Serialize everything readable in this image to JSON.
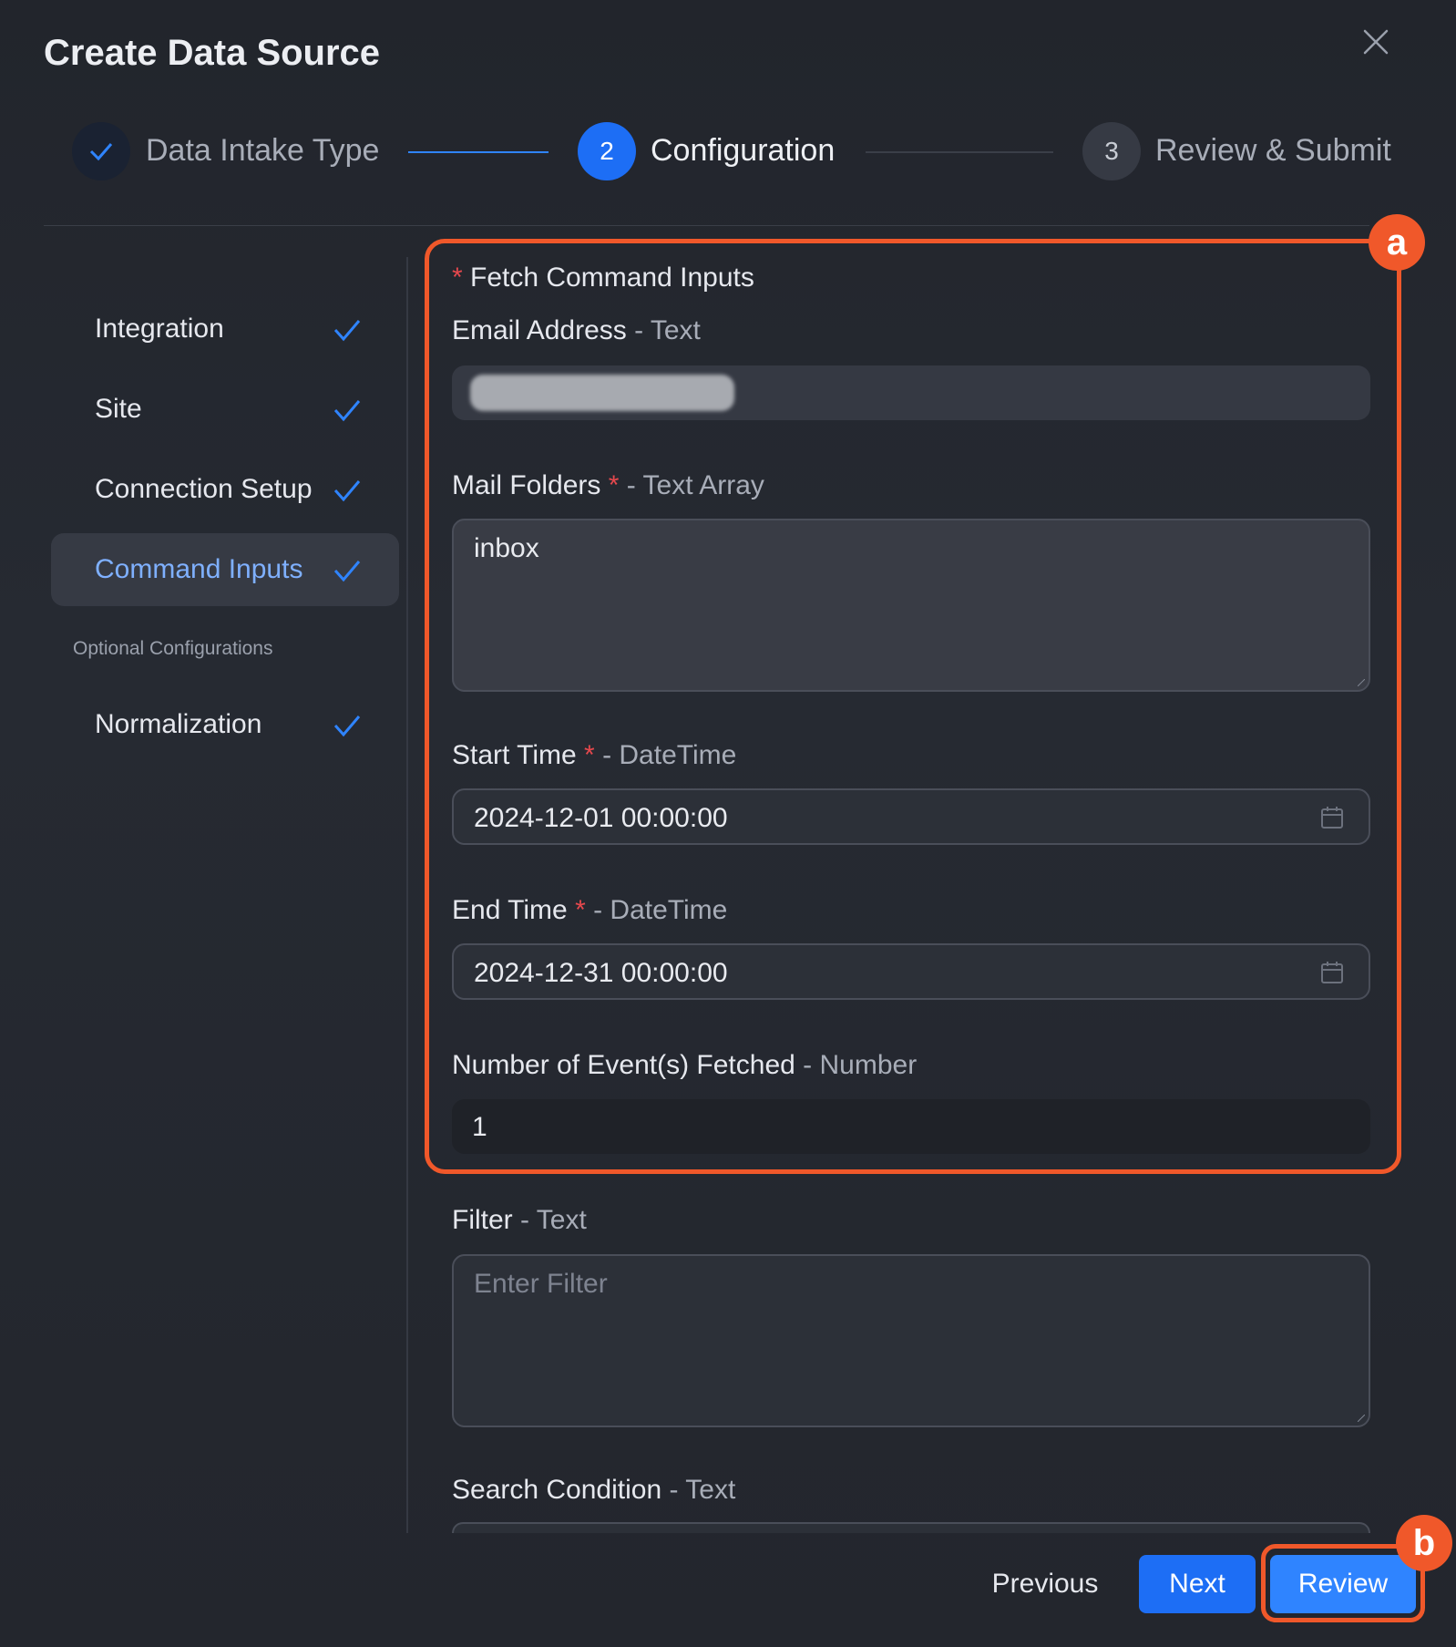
{
  "dialog": {
    "title": "Create Data Source"
  },
  "stepper": {
    "steps": [
      {
        "label": "Data Intake Type",
        "status": "done"
      },
      {
        "number": "2",
        "label": "Configuration",
        "status": "active"
      },
      {
        "number": "3",
        "label": "Review & Submit",
        "status": "pending"
      }
    ]
  },
  "sidebar": {
    "items": [
      {
        "label": "Integration"
      },
      {
        "label": "Site"
      },
      {
        "label": "Connection Setup"
      },
      {
        "label": "Command Inputs"
      }
    ],
    "optional_heading": "Optional Configurations",
    "optional_items": [
      {
        "label": "Normalization"
      }
    ]
  },
  "form": {
    "section_title": "Fetch Command Inputs",
    "section_required_mark": "*",
    "email": {
      "label": "Email Address",
      "type": " - Text"
    },
    "mail_folders": {
      "label": "Mail Folders",
      "req": "*",
      "type": " - Text Array",
      "value": "inbox"
    },
    "start_time": {
      "label": "Start Time",
      "req": "*",
      "type": " - DateTime",
      "value": "2024-12-01 00:00:00"
    },
    "end_time": {
      "label": "End Time",
      "req": "*",
      "type": " - DateTime",
      "value": "2024-12-31 00:00:00"
    },
    "num_events": {
      "label": "Number of Event(s) Fetched",
      "type": " - Number",
      "value": "1"
    },
    "filter": {
      "label": "Filter",
      "type": " - Text",
      "placeholder": "Enter Filter"
    },
    "search_condition": {
      "label": "Search Condition",
      "type": " - Text"
    }
  },
  "annotations": {
    "a": "a",
    "b": "b"
  },
  "footer": {
    "previous": "Previous",
    "next": "Next",
    "review": "Review"
  },
  "colors": {
    "accent": "#1d6ef5",
    "highlight": "#f0582a",
    "required": "#e5484d"
  }
}
